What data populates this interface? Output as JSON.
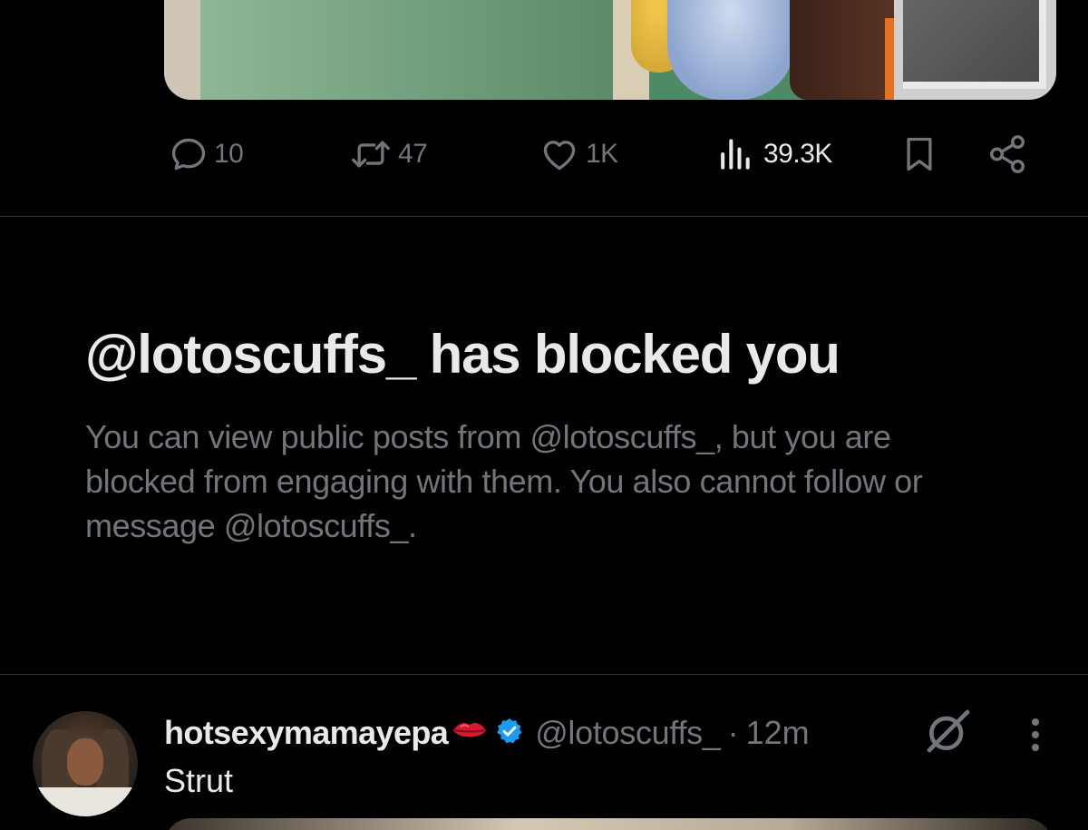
{
  "post_actions": {
    "reply_count": "10",
    "repost_count": "47",
    "like_count": "1K",
    "view_count": "39.3K",
    "icons": [
      "reply-icon",
      "repost-icon",
      "like-icon",
      "views-icon",
      "bookmark-icon",
      "share-icon"
    ]
  },
  "blocked_notice": {
    "title": "@lotoscuffs_ has blocked you",
    "body": "You can view public posts from @lotoscuffs_, but you are blocked from engaging with them. You also cannot follow or message @lotoscuffs_."
  },
  "next_post": {
    "display_name": "hotsexymamayepa",
    "handle": "@lotoscuffs_",
    "separator": "·",
    "time": "12m",
    "text": "Strut",
    "verified": true,
    "icons": [
      "lips-emoji",
      "verified-badge-icon",
      "grok-icon",
      "more-icon"
    ]
  },
  "colors": {
    "background": "#000000",
    "text_primary": "#e7e9ea",
    "text_secondary": "#71767b",
    "divider": "#2f3336",
    "verified_blue": "#1d9bf0"
  }
}
